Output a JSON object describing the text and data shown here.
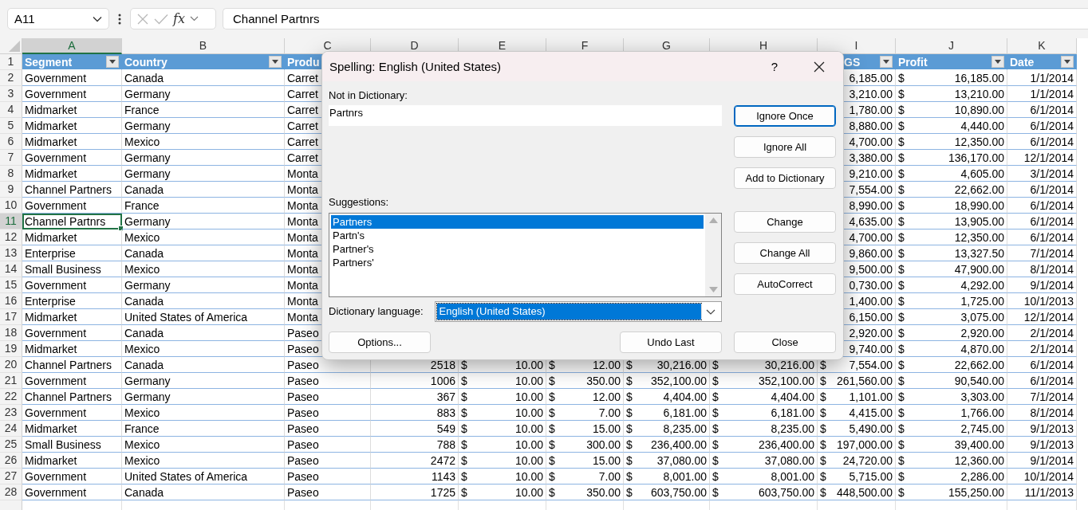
{
  "formula_bar": {
    "name_box": "A11",
    "function_label": "fx",
    "formula": "Channel Partnrs"
  },
  "sheet": {
    "columns": [
      {
        "letter": "A",
        "selected": true
      },
      {
        "letter": "B",
        "selected": false
      },
      {
        "letter": "C",
        "selected": false
      },
      {
        "letter": "D",
        "selected": false
      },
      {
        "letter": "E",
        "selected": false
      },
      {
        "letter": "F",
        "selected": false
      },
      {
        "letter": "G",
        "selected": false
      },
      {
        "letter": "H",
        "selected": false
      },
      {
        "letter": "I",
        "selected": false
      },
      {
        "letter": "J",
        "selected": false
      },
      {
        "letter": "K",
        "selected": false
      }
    ],
    "header_row": {
      "n": "1",
      "cells": {
        "a": {
          "text": "Segment",
          "filter": true
        },
        "b": {
          "text": "Country",
          "filter": true
        },
        "c": {
          "text": "Produ",
          "filter": false
        },
        "i": {
          "text": "GS",
          "filter": true
        },
        "j": {
          "text": "Profit",
          "filter": true
        },
        "k": {
          "text": "Date",
          "filter": true
        }
      }
    },
    "rows": [
      {
        "n": "2",
        "selected": false,
        "cells": {
          "a": "Government",
          "b": "Canada",
          "c": "Carret",
          "i": "6,185.00",
          "j": [
            "$",
            "16,185.00"
          ],
          "k": "1/1/2014"
        }
      },
      {
        "n": "3",
        "selected": false,
        "cells": {
          "a": "Government",
          "b": "Germany",
          "c": "Carret",
          "i": "3,210.00",
          "j": [
            "$",
            "13,210.00"
          ],
          "k": "1/1/2014"
        }
      },
      {
        "n": "4",
        "selected": false,
        "cells": {
          "a": "Midmarket",
          "b": "France",
          "c": "Carret",
          "i": "1,780.00",
          "j": [
            "$",
            "10,890.00"
          ],
          "k": "6/1/2014"
        }
      },
      {
        "n": "5",
        "selected": false,
        "cells": {
          "a": "Midmarket",
          "b": "Germany",
          "c": "Carret",
          "i": "8,880.00",
          "j": [
            "$",
            "4,440.00"
          ],
          "k": "6/1/2014"
        }
      },
      {
        "n": "6",
        "selected": false,
        "cells": {
          "a": "Midmarket",
          "b": "Mexico",
          "c": "Carret",
          "i": "4,700.00",
          "j": [
            "$",
            "12,350.00"
          ],
          "k": "6/1/2014"
        }
      },
      {
        "n": "7",
        "selected": false,
        "cells": {
          "a": "Government",
          "b": "Germany",
          "c": "Carret",
          "i": "3,380.00",
          "j": [
            "$",
            "136,170.00"
          ],
          "k": "12/1/2014"
        }
      },
      {
        "n": "8",
        "selected": false,
        "cells": {
          "a": "Midmarket",
          "b": "Germany",
          "c": "Monta",
          "i": "9,210.00",
          "j": [
            "$",
            "4,605.00"
          ],
          "k": "3/1/2014"
        }
      },
      {
        "n": "9",
        "selected": false,
        "cells": {
          "a": "Channel Partners",
          "b": "Canada",
          "c": "Monta",
          "i": "7,554.00",
          "j": [
            "$",
            "22,662.00"
          ],
          "k": "6/1/2014"
        }
      },
      {
        "n": "10",
        "selected": false,
        "cells": {
          "a": "Government",
          "b": "France",
          "c": "Monta",
          "i": "8,990.00",
          "j": [
            "$",
            "18,990.00"
          ],
          "k": "6/1/2014"
        }
      },
      {
        "n": "11",
        "selected": true,
        "cells": {
          "a": "Channel Partnrs",
          "b": "Germany",
          "c": "Monta",
          "i": "4,635.00",
          "j": [
            "$",
            "13,905.00"
          ],
          "k": "6/1/2014"
        }
      },
      {
        "n": "12",
        "selected": false,
        "cells": {
          "a": "Midmarket",
          "b": "Mexico",
          "c": "Monta",
          "i": "4,700.00",
          "j": [
            "$",
            "12,350.00"
          ],
          "k": "6/1/2014"
        }
      },
      {
        "n": "13",
        "selected": false,
        "cells": {
          "a": "Enterprise",
          "b": "Canada",
          "c": "Monta",
          "i": "9,860.00",
          "j": [
            "$",
            "13,327.50"
          ],
          "k": "7/1/2014"
        }
      },
      {
        "n": "14",
        "selected": false,
        "cells": {
          "a": "Small Business",
          "b": "Mexico",
          "c": "Monta",
          "i": "9,500.00",
          "j": [
            "$",
            "47,900.00"
          ],
          "k": "8/1/2014"
        }
      },
      {
        "n": "15",
        "selected": false,
        "cells": {
          "a": "Government",
          "b": "Germany",
          "c": "Monta",
          "i": "0,730.00",
          "j": [
            "$",
            "4,292.00"
          ],
          "k": "9/1/2014"
        }
      },
      {
        "n": "16",
        "selected": false,
        "cells": {
          "a": "Enterprise",
          "b": "Canada",
          "c": "Monta",
          "i": "1,400.00",
          "j": [
            "$",
            "1,725.00"
          ],
          "k": "10/1/2013"
        }
      },
      {
        "n": "17",
        "selected": false,
        "cells": {
          "a": "Midmarket",
          "b": "United States of America",
          "c": "Monta",
          "i": "6,150.00",
          "j": [
            "$",
            "3,075.00"
          ],
          "k": "12/1/2014"
        }
      },
      {
        "n": "18",
        "selected": false,
        "cells": {
          "a": "Government",
          "b": "Canada",
          "c": "Paseo",
          "i": "2,920.00",
          "j": [
            "$",
            "2,920.00"
          ],
          "k": "2/1/2014"
        }
      },
      {
        "n": "19",
        "selected": false,
        "cells": {
          "a": "Midmarket",
          "b": "Mexico",
          "c": "Paseo",
          "i": "9,740.00",
          "j": [
            "$",
            "4,870.00"
          ],
          "k": "2/1/2014"
        }
      },
      {
        "n": "20",
        "selected": false,
        "cells": {
          "a": "Channel Partners",
          "b": "Canada",
          "c": "Paseo",
          "d": "2518",
          "e": [
            "$",
            "10.00"
          ],
          "f": [
            "$",
            "12.00"
          ],
          "g": [
            "$",
            "30,216.00"
          ],
          "h": [
            "$",
            "30,216.00"
          ],
          "i": [
            "$",
            "7,554.00"
          ],
          "j": [
            "$",
            "22,662.00"
          ],
          "k": "6/1/2014"
        }
      },
      {
        "n": "21",
        "selected": false,
        "cells": {
          "a": "Government",
          "b": "Germany",
          "c": "Paseo",
          "d": "1006",
          "e": [
            "$",
            "10.00"
          ],
          "f": [
            "$",
            "350.00"
          ],
          "g": [
            "$",
            "352,100.00"
          ],
          "h": [
            "$",
            "352,100.00"
          ],
          "i": [
            "$",
            "261,560.00"
          ],
          "j": [
            "$",
            "90,540.00"
          ],
          "k": "6/1/2014"
        }
      },
      {
        "n": "22",
        "selected": false,
        "cells": {
          "a": "Channel Partners",
          "b": "Germany",
          "c": "Paseo",
          "d": "367",
          "e": [
            "$",
            "10.00"
          ],
          "f": [
            "$",
            "12.00"
          ],
          "g": [
            "$",
            "4,404.00"
          ],
          "h": [
            "$",
            "4,404.00"
          ],
          "i": [
            "$",
            "1,101.00"
          ],
          "j": [
            "$",
            "3,303.00"
          ],
          "k": "7/1/2014"
        }
      },
      {
        "n": "23",
        "selected": false,
        "cells": {
          "a": "Government",
          "b": "Mexico",
          "c": "Paseo",
          "d": "883",
          "e": [
            "$",
            "10.00"
          ],
          "f": [
            "$",
            "7.00"
          ],
          "g": [
            "$",
            "6,181.00"
          ],
          "h": [
            "$",
            "6,181.00"
          ],
          "i": [
            "$",
            "4,415.00"
          ],
          "j": [
            "$",
            "1,766.00"
          ],
          "k": "8/1/2014"
        }
      },
      {
        "n": "24",
        "selected": false,
        "cells": {
          "a": "Midmarket",
          "b": "France",
          "c": "Paseo",
          "d": "549",
          "e": [
            "$",
            "10.00"
          ],
          "f": [
            "$",
            "15.00"
          ],
          "g": [
            "$",
            "8,235.00"
          ],
          "h": [
            "$",
            "8,235.00"
          ],
          "i": [
            "$",
            "5,490.00"
          ],
          "j": [
            "$",
            "2,745.00"
          ],
          "k": "9/1/2013"
        }
      },
      {
        "n": "25",
        "selected": false,
        "cells": {
          "a": "Small Business",
          "b": "Mexico",
          "c": "Paseo",
          "d": "788",
          "e": [
            "$",
            "10.00"
          ],
          "f": [
            "$",
            "300.00"
          ],
          "g": [
            "$",
            "236,400.00"
          ],
          "h": [
            "$",
            "236,400.00"
          ],
          "i": [
            "$",
            "197,000.00"
          ],
          "j": [
            "$",
            "39,400.00"
          ],
          "k": "9/1/2013"
        }
      },
      {
        "n": "26",
        "selected": false,
        "cells": {
          "a": "Midmarket",
          "b": "Mexico",
          "c": "Paseo",
          "d": "2472",
          "e": [
            "$",
            "10.00"
          ],
          "f": [
            "$",
            "15.00"
          ],
          "g": [
            "$",
            "37,080.00"
          ],
          "h": [
            "$",
            "37,080.00"
          ],
          "i": [
            "$",
            "24,720.00"
          ],
          "j": [
            "$",
            "12,360.00"
          ],
          "k": "9/1/2014"
        }
      },
      {
        "n": "27",
        "selected": false,
        "cells": {
          "a": "Government",
          "b": "United States of America",
          "c": "Paseo",
          "d": "1143",
          "e": [
            "$",
            "10.00"
          ],
          "f": [
            "$",
            "7.00"
          ],
          "g": [
            "$",
            "8,001.00"
          ],
          "h": [
            "$",
            "8,001.00"
          ],
          "i": [
            "$",
            "5,715.00"
          ],
          "j": [
            "$",
            "2,286.00"
          ],
          "k": "10/1/2014"
        }
      },
      {
        "n": "28",
        "selected": false,
        "cells": {
          "a": "Government",
          "b": "Canada",
          "c": "Paseo",
          "d": "1725",
          "e": [
            "$",
            "10.00"
          ],
          "f": [
            "$",
            "350.00"
          ],
          "g": [
            "$",
            "603,750.00"
          ],
          "h": [
            "$",
            "603,750.00"
          ],
          "i": [
            "$",
            "448,500.00"
          ],
          "j": [
            "$",
            "155,250.00"
          ],
          "k": "11/1/2013"
        }
      }
    ]
  },
  "dialog": {
    "title": "Spelling: English (United States)",
    "help": "?",
    "not_in_dictionary": {
      "label": "Not in Dictionary:",
      "value": "Partnrs"
    },
    "suggestions": {
      "label": "Suggestions:",
      "items": [
        {
          "text": "Partners",
          "selected": true
        },
        {
          "text": "Partn's",
          "selected": false
        },
        {
          "text": "Partner's",
          "selected": false
        },
        {
          "text": "Partners'",
          "selected": false
        }
      ]
    },
    "dictionary_language": {
      "label": "Dictionary language:",
      "value": "English (United States)",
      "selected": true
    },
    "side_button_groups": [
      [
        {
          "label": "Ignore Once",
          "default": true
        },
        {
          "label": "Ignore All",
          "default": false
        },
        {
          "label": "Add to Dictionary",
          "default": false
        }
      ],
      [
        {
          "label": "Change",
          "default": false
        },
        {
          "label": "Change All",
          "default": false
        },
        {
          "label": "AutoCorrect",
          "default": false
        }
      ]
    ],
    "footer_buttons": [
      {
        "label": "Options...",
        "default": false
      },
      {
        "label": "Undo Last",
        "default": false
      },
      {
        "label": "Close",
        "default": false
      }
    ]
  }
}
